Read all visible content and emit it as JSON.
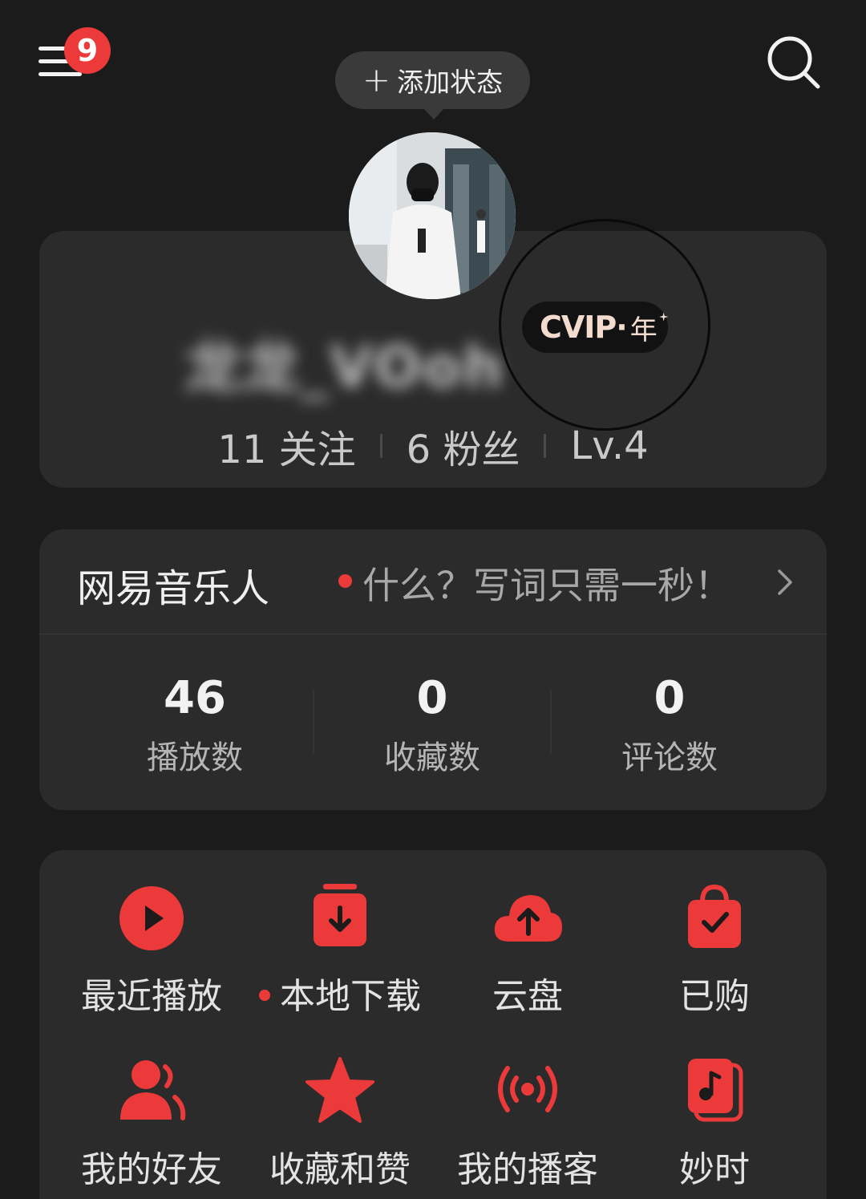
{
  "header": {
    "menu_badge_count": "9",
    "status_button_label": "添加状态",
    "status_button_icon": "plus-icon",
    "search_icon": "search-icon"
  },
  "profile": {
    "username": "龙龙_VOoh",
    "vip_logo": "CVIP·",
    "vip_period": "年",
    "following": "11 关注",
    "followers": "6 粉丝",
    "level": "Lv.4"
  },
  "musician": {
    "title": "网易音乐人",
    "promo": "什么？写词只需一秒！",
    "metrics": [
      {
        "value": "46",
        "label": "播放数"
      },
      {
        "value": "0",
        "label": "收藏数"
      },
      {
        "value": "0",
        "label": "评论数"
      }
    ]
  },
  "grid": {
    "items": [
      {
        "label": "最近播放",
        "icon": "play-circle-icon"
      },
      {
        "label": "本地下载",
        "icon": "download-box-icon",
        "dot": true
      },
      {
        "label": "云盘",
        "icon": "cloud-upload-icon"
      },
      {
        "label": "已购",
        "icon": "shopping-bag-check-icon"
      },
      {
        "label": "我的好友",
        "icon": "friends-icon"
      },
      {
        "label": "收藏和赞",
        "icon": "star-icon"
      },
      {
        "label": "我的播客",
        "icon": "broadcast-icon"
      },
      {
        "label": "妙时",
        "icon": "music-note-card-icon"
      }
    ]
  },
  "colors": {
    "background": "#1b1b1b",
    "card": "#2b2b2b",
    "accent_red": "#ec3a3a"
  }
}
